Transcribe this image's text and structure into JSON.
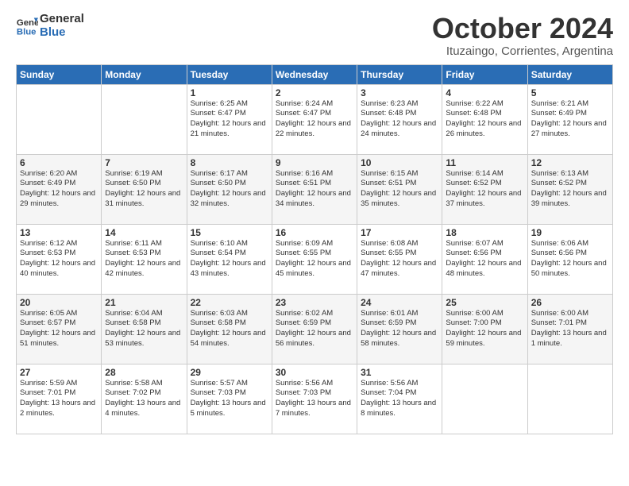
{
  "header": {
    "logo_line1": "General",
    "logo_line2": "Blue",
    "title": "October 2024",
    "subtitle": "Ituzaingo, Corrientes, Argentina"
  },
  "weekdays": [
    "Sunday",
    "Monday",
    "Tuesday",
    "Wednesday",
    "Thursday",
    "Friday",
    "Saturday"
  ],
  "weeks": [
    [
      {
        "day": "",
        "info": ""
      },
      {
        "day": "",
        "info": ""
      },
      {
        "day": "1",
        "info": "Sunrise: 6:25 AM\nSunset: 6:47 PM\nDaylight: 12 hours and 21 minutes."
      },
      {
        "day": "2",
        "info": "Sunrise: 6:24 AM\nSunset: 6:47 PM\nDaylight: 12 hours and 22 minutes."
      },
      {
        "day": "3",
        "info": "Sunrise: 6:23 AM\nSunset: 6:48 PM\nDaylight: 12 hours and 24 minutes."
      },
      {
        "day": "4",
        "info": "Sunrise: 6:22 AM\nSunset: 6:48 PM\nDaylight: 12 hours and 26 minutes."
      },
      {
        "day": "5",
        "info": "Sunrise: 6:21 AM\nSunset: 6:49 PM\nDaylight: 12 hours and 27 minutes."
      }
    ],
    [
      {
        "day": "6",
        "info": "Sunrise: 6:20 AM\nSunset: 6:49 PM\nDaylight: 12 hours and 29 minutes."
      },
      {
        "day": "7",
        "info": "Sunrise: 6:19 AM\nSunset: 6:50 PM\nDaylight: 12 hours and 31 minutes."
      },
      {
        "day": "8",
        "info": "Sunrise: 6:17 AM\nSunset: 6:50 PM\nDaylight: 12 hours and 32 minutes."
      },
      {
        "day": "9",
        "info": "Sunrise: 6:16 AM\nSunset: 6:51 PM\nDaylight: 12 hours and 34 minutes."
      },
      {
        "day": "10",
        "info": "Sunrise: 6:15 AM\nSunset: 6:51 PM\nDaylight: 12 hours and 35 minutes."
      },
      {
        "day": "11",
        "info": "Sunrise: 6:14 AM\nSunset: 6:52 PM\nDaylight: 12 hours and 37 minutes."
      },
      {
        "day": "12",
        "info": "Sunrise: 6:13 AM\nSunset: 6:52 PM\nDaylight: 12 hours and 39 minutes."
      }
    ],
    [
      {
        "day": "13",
        "info": "Sunrise: 6:12 AM\nSunset: 6:53 PM\nDaylight: 12 hours and 40 minutes."
      },
      {
        "day": "14",
        "info": "Sunrise: 6:11 AM\nSunset: 6:53 PM\nDaylight: 12 hours and 42 minutes."
      },
      {
        "day": "15",
        "info": "Sunrise: 6:10 AM\nSunset: 6:54 PM\nDaylight: 12 hours and 43 minutes."
      },
      {
        "day": "16",
        "info": "Sunrise: 6:09 AM\nSunset: 6:55 PM\nDaylight: 12 hours and 45 minutes."
      },
      {
        "day": "17",
        "info": "Sunrise: 6:08 AM\nSunset: 6:55 PM\nDaylight: 12 hours and 47 minutes."
      },
      {
        "day": "18",
        "info": "Sunrise: 6:07 AM\nSunset: 6:56 PM\nDaylight: 12 hours and 48 minutes."
      },
      {
        "day": "19",
        "info": "Sunrise: 6:06 AM\nSunset: 6:56 PM\nDaylight: 12 hours and 50 minutes."
      }
    ],
    [
      {
        "day": "20",
        "info": "Sunrise: 6:05 AM\nSunset: 6:57 PM\nDaylight: 12 hours and 51 minutes."
      },
      {
        "day": "21",
        "info": "Sunrise: 6:04 AM\nSunset: 6:58 PM\nDaylight: 12 hours and 53 minutes."
      },
      {
        "day": "22",
        "info": "Sunrise: 6:03 AM\nSunset: 6:58 PM\nDaylight: 12 hours and 54 minutes."
      },
      {
        "day": "23",
        "info": "Sunrise: 6:02 AM\nSunset: 6:59 PM\nDaylight: 12 hours and 56 minutes."
      },
      {
        "day": "24",
        "info": "Sunrise: 6:01 AM\nSunset: 6:59 PM\nDaylight: 12 hours and 58 minutes."
      },
      {
        "day": "25",
        "info": "Sunrise: 6:00 AM\nSunset: 7:00 PM\nDaylight: 12 hours and 59 minutes."
      },
      {
        "day": "26",
        "info": "Sunrise: 6:00 AM\nSunset: 7:01 PM\nDaylight: 13 hours and 1 minute."
      }
    ],
    [
      {
        "day": "27",
        "info": "Sunrise: 5:59 AM\nSunset: 7:01 PM\nDaylight: 13 hours and 2 minutes."
      },
      {
        "day": "28",
        "info": "Sunrise: 5:58 AM\nSunset: 7:02 PM\nDaylight: 13 hours and 4 minutes."
      },
      {
        "day": "29",
        "info": "Sunrise: 5:57 AM\nSunset: 7:03 PM\nDaylight: 13 hours and 5 minutes."
      },
      {
        "day": "30",
        "info": "Sunrise: 5:56 AM\nSunset: 7:03 PM\nDaylight: 13 hours and 7 minutes."
      },
      {
        "day": "31",
        "info": "Sunrise: 5:56 AM\nSunset: 7:04 PM\nDaylight: 13 hours and 8 minutes."
      },
      {
        "day": "",
        "info": ""
      },
      {
        "day": "",
        "info": ""
      }
    ]
  ]
}
